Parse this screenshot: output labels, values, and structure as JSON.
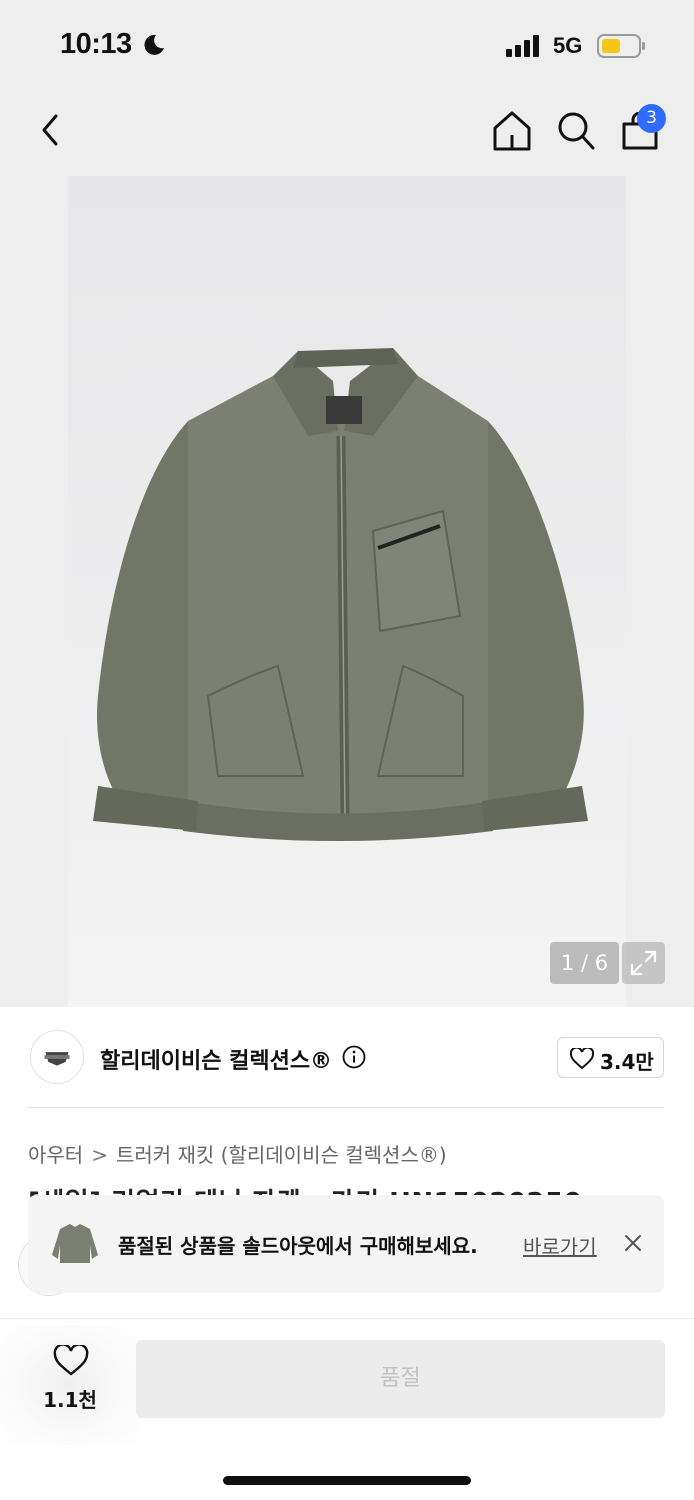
{
  "status_bar": {
    "time": "10:13",
    "network": "5G"
  },
  "nav": {
    "cart_count": "3"
  },
  "product_image": {
    "counter": "1 / 6"
  },
  "brand": {
    "name": "할리데이비슨 컬렉션스®",
    "likes": "3.4만"
  },
  "breadcrumb": {
    "category": "아우터",
    "subcategory": "트러커 재킷 (할리데이비슨 컬렉션스®)"
  },
  "product": {
    "title_partial": "[세일] 리얼리 데님 자켓 · 카키 HN15020250"
  },
  "toast": {
    "message": "품절된 상품을 솔드아웃에서 구매해보세요.",
    "link_label": "바로가기"
  },
  "bottom_bar": {
    "favorite_count": "1.1천",
    "buy_label": "품절"
  },
  "colors": {
    "badge": "#2f6bff",
    "disabled_button": "#ececec",
    "jacket": "#757a6e"
  },
  "icons": [
    "moon-icon",
    "signal-icon",
    "battery-icon",
    "back-icon",
    "home-icon",
    "search-icon",
    "bag-icon",
    "expand-icon",
    "info-icon",
    "heart-icon",
    "close-icon"
  ]
}
